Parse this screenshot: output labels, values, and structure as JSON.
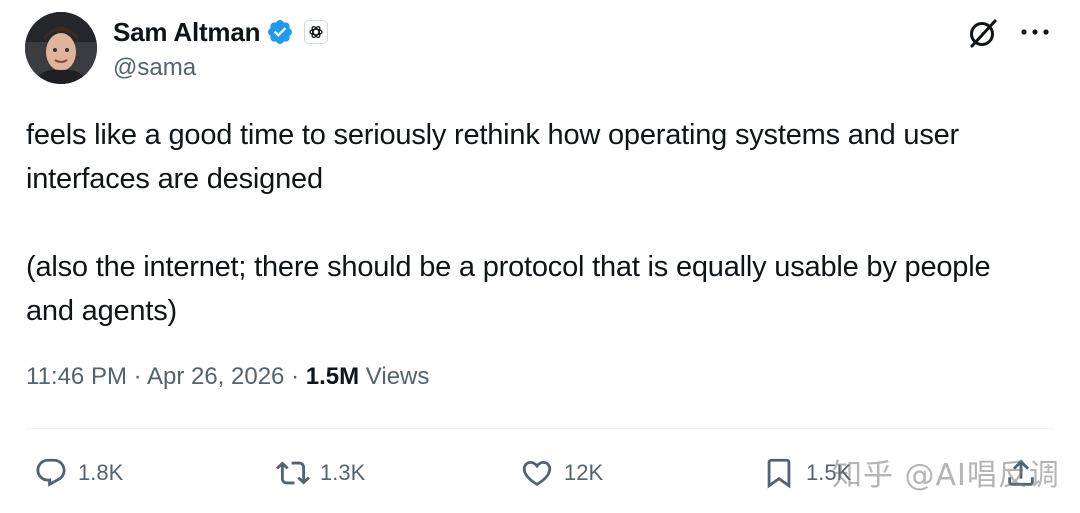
{
  "author": {
    "display_name": "Sam Altman",
    "handle": "@sama"
  },
  "tweet": {
    "paragraphs": [
      "feels like a good time to seriously rethink how operating systems and user interfaces are designed",
      "(also the internet; there should be a protocol that is equally usable by people and agents)"
    ],
    "time": "11:46 PM",
    "separator": "·",
    "date": "Apr 26, 2026",
    "views_count": "1.5M",
    "views_label": "Views"
  },
  "actions": {
    "replies": "1.8K",
    "reposts": "1.3K",
    "likes": "12K",
    "bookmarks": "1.5K"
  },
  "watermark": "知乎 @AI唱反调",
  "colors": {
    "verified": "#1d9bf0",
    "text": "#0f1419",
    "secondary": "#536471"
  },
  "icons": [
    "verified-badge-icon",
    "openai-org-badge-icon",
    "grok-icon",
    "more-icon",
    "reply-icon",
    "repost-icon",
    "like-icon",
    "bookmark-icon",
    "share-icon"
  ]
}
